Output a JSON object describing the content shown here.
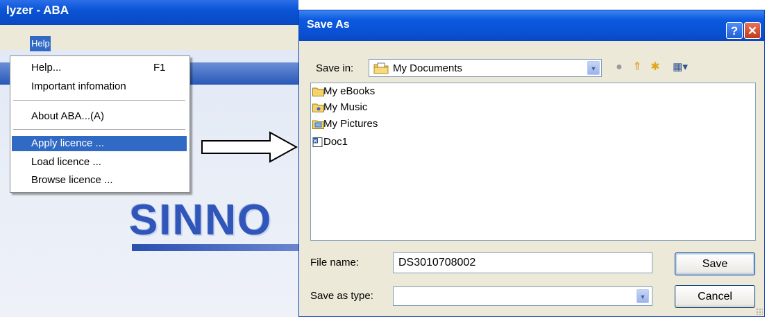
{
  "app": {
    "title": "lyzer - ABA",
    "menu_help": "Help",
    "logo_text": "SINNO",
    "help_menu": {
      "items": [
        {
          "label": "Help...",
          "shortcut": "F1"
        },
        {
          "label": "Important infomation"
        },
        {
          "label": "About ABA...(A)"
        },
        {
          "label": "Apply licence ...",
          "highlighted": true
        },
        {
          "label": "Load licence ..."
        },
        {
          "label": "Browse licence ..."
        }
      ]
    }
  },
  "dialog": {
    "title": "Save As",
    "title_buttons": {
      "help": "?",
      "close": "✕"
    },
    "save_in_label": "Save in:",
    "save_in_value": "My Documents",
    "toolbar_icons": [
      "back-icon",
      "up-folder-icon",
      "new-folder-icon",
      "views-menu-icon"
    ],
    "files": [
      {
        "name": "My eBooks",
        "icon": "folder-icon"
      },
      {
        "name": "My Music",
        "icon": "music-folder-icon"
      },
      {
        "name": "My Pictures",
        "icon": "pictures-folder-icon"
      },
      {
        "name": "Doc1",
        "icon": "word-document-icon"
      }
    ],
    "file_name_label": "File name:",
    "file_name_value": "DS3010708002",
    "save_type_label": "Save as type:",
    "save_type_value": "",
    "save_button": "Save",
    "cancel_button": "Cancel"
  },
  "colors": {
    "xp_title_blue": "#0a55d6",
    "menu_highlight": "#316ac5",
    "dialog_face": "#ece9d8",
    "logo_blue": "#2f56b8"
  }
}
